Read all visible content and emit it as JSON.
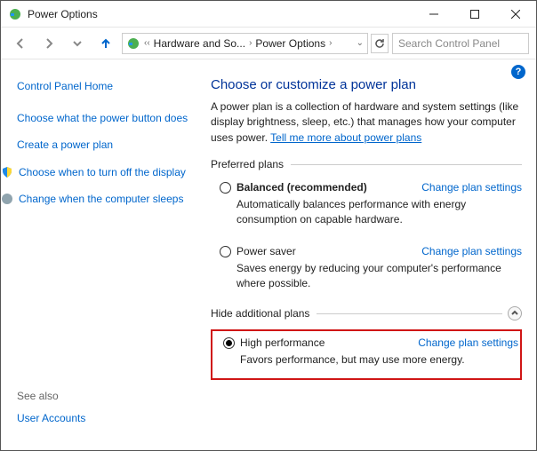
{
  "window": {
    "title": "Power Options"
  },
  "breadcrumb": {
    "item1": "Hardware and So...",
    "item2": "Power Options"
  },
  "search": {
    "placeholder": "Search Control Panel"
  },
  "sidebar": {
    "home": "Control Panel Home",
    "link1": "Choose what the power button does",
    "link2": "Create a power plan",
    "link3": "Choose when to turn off the display",
    "link4": "Change when the computer sleeps"
  },
  "seealso": {
    "label": "See also",
    "link": "User Accounts"
  },
  "main": {
    "heading": "Choose or customize a power plan",
    "desc_pre": "A power plan is a collection of hardware and system settings (like display brightness, sleep, etc.) that manages how your computer uses power. ",
    "desc_link": "Tell me more about power plans",
    "preferred_label": "Preferred plans",
    "hide_label": "Hide additional plans",
    "change_settings": "Change plan settings",
    "plans": {
      "balanced": {
        "name": "Balanced (recommended)",
        "desc": "Automatically balances performance with energy consumption on capable hardware."
      },
      "saver": {
        "name": "Power saver",
        "desc": "Saves energy by reducing your computer's performance where possible."
      },
      "high": {
        "name": "High performance",
        "desc": "Favors performance, but may use more energy."
      }
    }
  }
}
